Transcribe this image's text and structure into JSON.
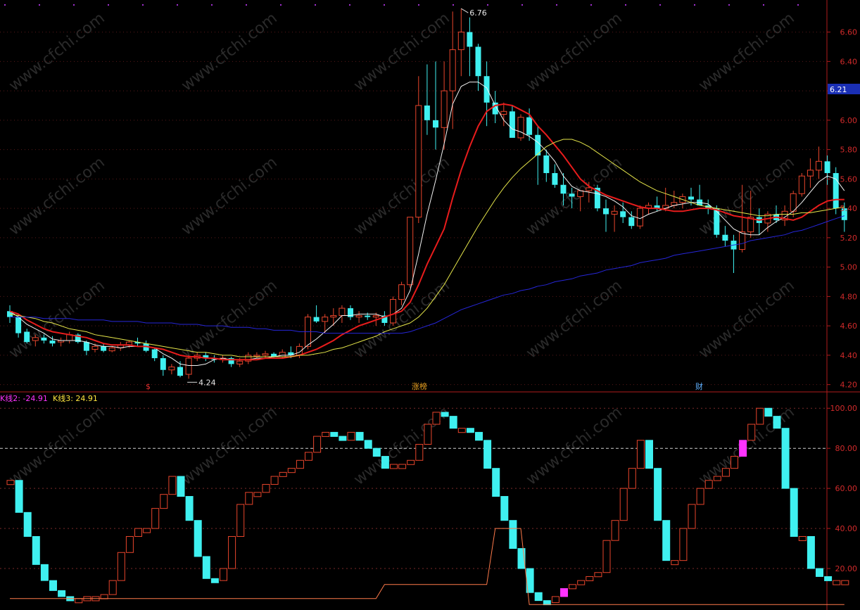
{
  "colors": {
    "background": "#000000",
    "axis": "#b11b1b",
    "grid": "#5a1a1a",
    "up": "#e8452c",
    "down": "#3ff0f0",
    "ma5": "#f2f2f2",
    "ma10": "#e81c1c",
    "ma20": "#e6e64a",
    "ma60": "#2626d8",
    "kline2": "#ff33ff",
    "kline3": "#ffe640",
    "price_badge": "#1a2fb5"
  },
  "watermark": "www.cfchi.com",
  "price_panel": {
    "y_ticks": [
      "6.60",
      "6.40",
      "6.20",
      "6.00",
      "5.80",
      "5.60",
      "5.40",
      "5.20",
      "5.00",
      "4.80",
      "4.60",
      "4.40",
      "4.20"
    ],
    "current_price_badge": "6.21",
    "high_label": "6.76",
    "low_label": "4.24",
    "event_markers": [
      "$",
      "涨榜",
      "财"
    ]
  },
  "indicator_panel": {
    "legend": [
      {
        "label": "K线2: -24.91",
        "color": "#ff33ff"
      },
      {
        "label": "K线3: 24.91",
        "color": "#ffe640"
      }
    ],
    "y_ticks": [
      "100.00",
      "80.00",
      "60.00",
      "40.00",
      "20.00"
    ]
  },
  "chart_data": [
    {
      "type": "candlestick",
      "title": "",
      "ylim": [
        4.16,
        6.78
      ],
      "y_ticks": [
        6.6,
        6.4,
        6.2,
        6.0,
        5.8,
        5.6,
        5.4,
        5.2,
        5.0,
        4.8,
        4.6,
        4.4,
        4.2
      ],
      "grid": true,
      "candles": [
        [
          4.7,
          4.74,
          4.62,
          4.66
        ],
        [
          4.66,
          4.68,
          4.52,
          4.55
        ],
        [
          4.56,
          4.58,
          4.48,
          4.49
        ],
        [
          4.5,
          4.54,
          4.46,
          4.52
        ],
        [
          4.52,
          4.54,
          4.48,
          4.5
        ],
        [
          4.5,
          4.53,
          4.46,
          4.48
        ],
        [
          4.49,
          4.52,
          4.46,
          4.5
        ],
        [
          4.5,
          4.56,
          4.48,
          4.54
        ],
        [
          4.54,
          4.55,
          4.48,
          4.49
        ],
        [
          4.49,
          4.5,
          4.4,
          4.43
        ],
        [
          4.44,
          4.48,
          4.42,
          4.46
        ],
        [
          4.46,
          4.48,
          4.42,
          4.43
        ],
        [
          4.43,
          4.46,
          4.42,
          4.45
        ],
        [
          4.45,
          4.49,
          4.43,
          4.47
        ],
        [
          4.47,
          4.5,
          4.45,
          4.49
        ],
        [
          4.49,
          4.52,
          4.46,
          4.48
        ],
        [
          4.48,
          4.5,
          4.42,
          4.43
        ],
        [
          4.44,
          4.45,
          4.36,
          4.38
        ],
        [
          4.38,
          4.4,
          4.26,
          4.3
        ],
        [
          4.3,
          4.34,
          4.27,
          4.32
        ],
        [
          4.32,
          4.36,
          4.25,
          4.26
        ],
        [
          4.27,
          4.4,
          4.24,
          4.38
        ],
        [
          4.38,
          4.42,
          4.36,
          4.4
        ],
        [
          4.4,
          4.42,
          4.36,
          4.38
        ],
        [
          4.38,
          4.4,
          4.35,
          4.37
        ],
        [
          4.37,
          4.4,
          4.35,
          4.38
        ],
        [
          4.38,
          4.39,
          4.32,
          4.34
        ],
        [
          4.34,
          4.38,
          4.32,
          4.36
        ],
        [
          4.36,
          4.42,
          4.34,
          4.4
        ],
        [
          4.4,
          4.42,
          4.38,
          4.4
        ],
        [
          4.4,
          4.43,
          4.38,
          4.41
        ],
        [
          4.41,
          4.42,
          4.38,
          4.39
        ],
        [
          4.39,
          4.44,
          4.38,
          4.42
        ],
        [
          4.42,
          4.46,
          4.38,
          4.4
        ],
        [
          4.4,
          4.48,
          4.38,
          4.46
        ],
        [
          4.46,
          4.68,
          4.44,
          4.66
        ],
        [
          4.66,
          4.74,
          4.62,
          4.63
        ],
        [
          4.63,
          4.68,
          4.55,
          4.66
        ],
        [
          4.66,
          4.72,
          4.6,
          4.67
        ],
        [
          4.67,
          4.74,
          4.62,
          4.72
        ],
        [
          4.72,
          4.74,
          4.64,
          4.66
        ],
        [
          4.66,
          4.7,
          4.62,
          4.67
        ],
        [
          4.67,
          4.69,
          4.64,
          4.66
        ],
        [
          4.66,
          4.69,
          4.6,
          4.67
        ],
        [
          4.67,
          4.7,
          4.6,
          4.62
        ],
        [
          4.62,
          4.8,
          4.6,
          4.78
        ],
        [
          4.78,
          4.9,
          4.74,
          4.88
        ],
        [
          4.88,
          5.26,
          4.86,
          5.34
        ],
        [
          5.34,
          6.3,
          5.3,
          6.1
        ],
        [
          6.1,
          6.38,
          5.9,
          6.0
        ],
        [
          6.0,
          6.4,
          5.8,
          5.95
        ],
        [
          5.95,
          6.4,
          5.8,
          6.2
        ],
        [
          6.2,
          6.74,
          5.94,
          6.48
        ],
        [
          6.48,
          6.76,
          6.3,
          6.6
        ],
        [
          6.6,
          6.7,
          6.3,
          6.5
        ],
        [
          6.5,
          6.52,
          6.2,
          6.3
        ],
        [
          6.3,
          6.4,
          5.96,
          6.12
        ],
        [
          6.12,
          6.2,
          5.98,
          6.04
        ],
        [
          6.04,
          6.12,
          5.96,
          6.06
        ],
        [
          6.06,
          6.1,
          5.9,
          5.88
        ],
        [
          5.88,
          6.04,
          5.86,
          6.02
        ],
        [
          6.02,
          6.08,
          5.86,
          5.9
        ],
        [
          5.9,
          5.96,
          5.56,
          5.76
        ],
        [
          5.76,
          5.8,
          5.58,
          5.64
        ],
        [
          5.64,
          5.7,
          5.54,
          5.56
        ],
        [
          5.56,
          5.64,
          5.42,
          5.5
        ],
        [
          5.5,
          5.54,
          5.4,
          5.48
        ],
        [
          5.48,
          5.52,
          5.38,
          5.52
        ],
        [
          5.52,
          5.58,
          5.44,
          5.54
        ],
        [
          5.54,
          5.56,
          5.38,
          5.4
        ],
        [
          5.4,
          5.46,
          5.24,
          5.36
        ],
        [
          5.36,
          5.42,
          5.24,
          5.38
        ],
        [
          5.38,
          5.44,
          5.3,
          5.34
        ],
        [
          5.34,
          5.38,
          5.26,
          5.28
        ],
        [
          5.28,
          5.42,
          5.26,
          5.4
        ],
        [
          5.4,
          5.44,
          5.36,
          5.42
        ],
        [
          5.42,
          5.48,
          5.38,
          5.4
        ],
        [
          5.4,
          5.54,
          5.38,
          5.42
        ],
        [
          5.42,
          5.52,
          5.4,
          5.44
        ],
        [
          5.44,
          5.5,
          5.4,
          5.48
        ],
        [
          5.48,
          5.54,
          5.42,
          5.46
        ],
        [
          5.46,
          5.56,
          5.42,
          5.42
        ],
        [
          5.42,
          5.46,
          5.36,
          5.4
        ],
        [
          5.4,
          5.42,
          5.2,
          5.22
        ],
        [
          5.22,
          5.28,
          5.14,
          5.18
        ],
        [
          5.18,
          5.22,
          4.96,
          5.12
        ],
        [
          5.12,
          5.56,
          5.1,
          5.24
        ],
        [
          5.24,
          5.52,
          5.2,
          5.34
        ],
        [
          5.34,
          5.4,
          5.22,
          5.3
        ],
        [
          5.3,
          5.38,
          5.24,
          5.36
        ],
        [
          5.36,
          5.42,
          5.3,
          5.32
        ],
        [
          5.32,
          5.42,
          5.28,
          5.38
        ],
        [
          5.38,
          5.52,
          5.34,
          5.5
        ],
        [
          5.5,
          5.64,
          5.48,
          5.62
        ],
        [
          5.62,
          5.74,
          5.54,
          5.66
        ],
        [
          5.66,
          5.82,
          5.6,
          5.72
        ],
        [
          5.72,
          5.76,
          5.56,
          5.64
        ],
        [
          5.64,
          5.68,
          5.36,
          5.4
        ],
        [
          5.4,
          5.44,
          5.24,
          5.32
        ]
      ],
      "series": [
        {
          "name": "MA5",
          "values": [
            4.7,
            4.66,
            4.61,
            4.58,
            4.55,
            4.51,
            4.5,
            4.5,
            4.5,
            4.49,
            4.47,
            4.46,
            4.46,
            4.45,
            4.46,
            4.46,
            4.46,
            4.45,
            4.41,
            4.38,
            4.34,
            4.33,
            4.33,
            4.34,
            4.37,
            4.38,
            4.37,
            4.37,
            4.37,
            4.38,
            4.38,
            4.39,
            4.4,
            4.4,
            4.42,
            4.47,
            4.51,
            4.56,
            4.61,
            4.67,
            4.67,
            4.68,
            4.68,
            4.68,
            4.66,
            4.68,
            4.72,
            4.84,
            5.09,
            5.36,
            5.59,
            5.84,
            6.11,
            6.23,
            6.26,
            6.26,
            6.22,
            6.1,
            6.0,
            5.94,
            5.92,
            5.89,
            5.85,
            5.79,
            5.72,
            5.62,
            5.55,
            5.52,
            5.51,
            5.5,
            5.48,
            5.45,
            5.41,
            5.35,
            5.33,
            5.36,
            5.38,
            5.4,
            5.42,
            5.43,
            5.44,
            5.44,
            5.43,
            5.38,
            5.32,
            5.26,
            5.23,
            5.22,
            5.22,
            5.27,
            5.31,
            5.34,
            5.38,
            5.44,
            5.51,
            5.58,
            5.62,
            5.6,
            5.52
          ]
        },
        {
          "name": "MA10",
          "values": [
            4.7,
            4.68,
            4.64,
            4.61,
            4.58,
            4.56,
            4.55,
            4.54,
            4.53,
            4.52,
            4.5,
            4.48,
            4.47,
            4.47,
            4.47,
            4.46,
            4.46,
            4.45,
            4.44,
            4.42,
            4.4,
            4.39,
            4.39,
            4.38,
            4.38,
            4.37,
            4.37,
            4.37,
            4.37,
            4.37,
            4.38,
            4.38,
            4.38,
            4.39,
            4.4,
            4.42,
            4.44,
            4.47,
            4.5,
            4.54,
            4.57,
            4.6,
            4.62,
            4.64,
            4.66,
            4.68,
            4.7,
            4.76,
            4.88,
            5.02,
            5.14,
            5.26,
            5.47,
            5.66,
            5.82,
            5.96,
            6.06,
            6.1,
            6.11,
            6.1,
            6.07,
            6.04,
            5.96,
            5.9,
            5.83,
            5.76,
            5.68,
            5.6,
            5.55,
            5.52,
            5.49,
            5.47,
            5.45,
            5.43,
            5.41,
            5.4,
            5.4,
            5.39,
            5.38,
            5.38,
            5.39,
            5.4,
            5.4,
            5.39,
            5.37,
            5.35,
            5.34,
            5.33,
            5.32,
            5.33,
            5.34,
            5.33,
            5.32,
            5.34,
            5.38,
            5.42,
            5.45,
            5.46,
            5.46
          ]
        },
        {
          "name": "MA20",
          "values": [
            4.68,
            4.67,
            4.66,
            4.65,
            4.63,
            4.62,
            4.6,
            4.58,
            4.57,
            4.56,
            4.54,
            4.53,
            4.52,
            4.51,
            4.5,
            4.49,
            4.48,
            4.47,
            4.46,
            4.45,
            4.44,
            4.43,
            4.42,
            4.42,
            4.41,
            4.4,
            4.4,
            4.39,
            4.39,
            4.39,
            4.39,
            4.39,
            4.39,
            4.39,
            4.4,
            4.4,
            4.41,
            4.42,
            4.44,
            4.45,
            4.47,
            4.49,
            4.51,
            4.53,
            4.56,
            4.58,
            4.6,
            4.62,
            4.66,
            4.72,
            4.8,
            4.88,
            4.98,
            5.08,
            5.18,
            5.28,
            5.37,
            5.46,
            5.54,
            5.61,
            5.67,
            5.72,
            5.77,
            5.82,
            5.85,
            5.87,
            5.87,
            5.85,
            5.82,
            5.78,
            5.74,
            5.7,
            5.66,
            5.62,
            5.58,
            5.55,
            5.52,
            5.5,
            5.48,
            5.46,
            5.44,
            5.42,
            5.41,
            5.4,
            5.39,
            5.38,
            5.37,
            5.36,
            5.35,
            5.35,
            5.36,
            5.36,
            5.36,
            5.37,
            5.37,
            5.38,
            5.39,
            5.4,
            5.41
          ]
        },
        {
          "name": "MA60",
          "values": [
            4.66,
            4.66,
            4.66,
            4.66,
            4.65,
            4.65,
            4.65,
            4.65,
            4.64,
            4.64,
            4.64,
            4.64,
            4.63,
            4.63,
            4.63,
            4.63,
            4.62,
            4.62,
            4.62,
            4.62,
            4.61,
            4.61,
            4.61,
            4.6,
            4.6,
            4.6,
            4.59,
            4.59,
            4.59,
            4.58,
            4.58,
            4.57,
            4.57,
            4.57,
            4.56,
            4.56,
            4.56,
            4.55,
            4.55,
            4.55,
            4.55,
            4.55,
            4.55,
            4.55,
            4.55,
            4.55,
            4.55,
            4.56,
            4.58,
            4.6,
            4.62,
            4.65,
            4.68,
            4.71,
            4.73,
            4.75,
            4.77,
            4.79,
            4.81,
            4.82,
            4.84,
            4.85,
            4.87,
            4.88,
            4.9,
            4.91,
            4.92,
            4.94,
            4.95,
            4.96,
            4.98,
            4.99,
            5.0,
            5.01,
            5.03,
            5.04,
            5.05,
            5.06,
            5.08,
            5.09,
            5.1,
            5.11,
            5.12,
            5.13,
            5.14,
            5.15,
            5.16,
            5.18,
            5.19,
            5.2,
            5.21,
            5.22,
            5.24,
            5.25,
            5.27,
            5.29,
            5.31,
            5.33,
            5.35
          ]
        }
      ]
    },
    {
      "type": "bar",
      "title": "",
      "ylim": [
        0,
        105
      ],
      "y_ticks": [
        100,
        80,
        60,
        40,
        20
      ],
      "grid": true,
      "values": [
        64,
        48,
        36,
        22,
        14,
        9,
        6,
        5,
        5,
        6,
        6,
        7,
        14,
        28,
        36,
        40,
        40,
        50,
        57,
        66,
        56,
        44,
        26,
        15,
        14,
        20,
        36,
        52,
        58,
        58,
        62,
        66,
        68,
        70,
        74,
        78,
        86,
        88,
        86,
        84,
        88,
        84,
        80,
        76,
        70,
        72,
        72,
        74,
        82,
        92,
        98,
        96,
        90,
        90,
        88,
        84,
        70,
        56,
        44,
        30,
        20,
        8,
        4,
        3,
        6,
        10,
        12,
        14,
        16,
        18,
        34,
        44,
        60,
        70,
        84,
        70,
        44,
        24,
        24,
        40,
        52,
        60,
        64,
        66,
        70,
        76,
        84,
        92,
        100,
        96,
        90,
        60,
        36,
        36,
        20,
        16,
        14,
        14,
        14
      ]
    }
  ]
}
